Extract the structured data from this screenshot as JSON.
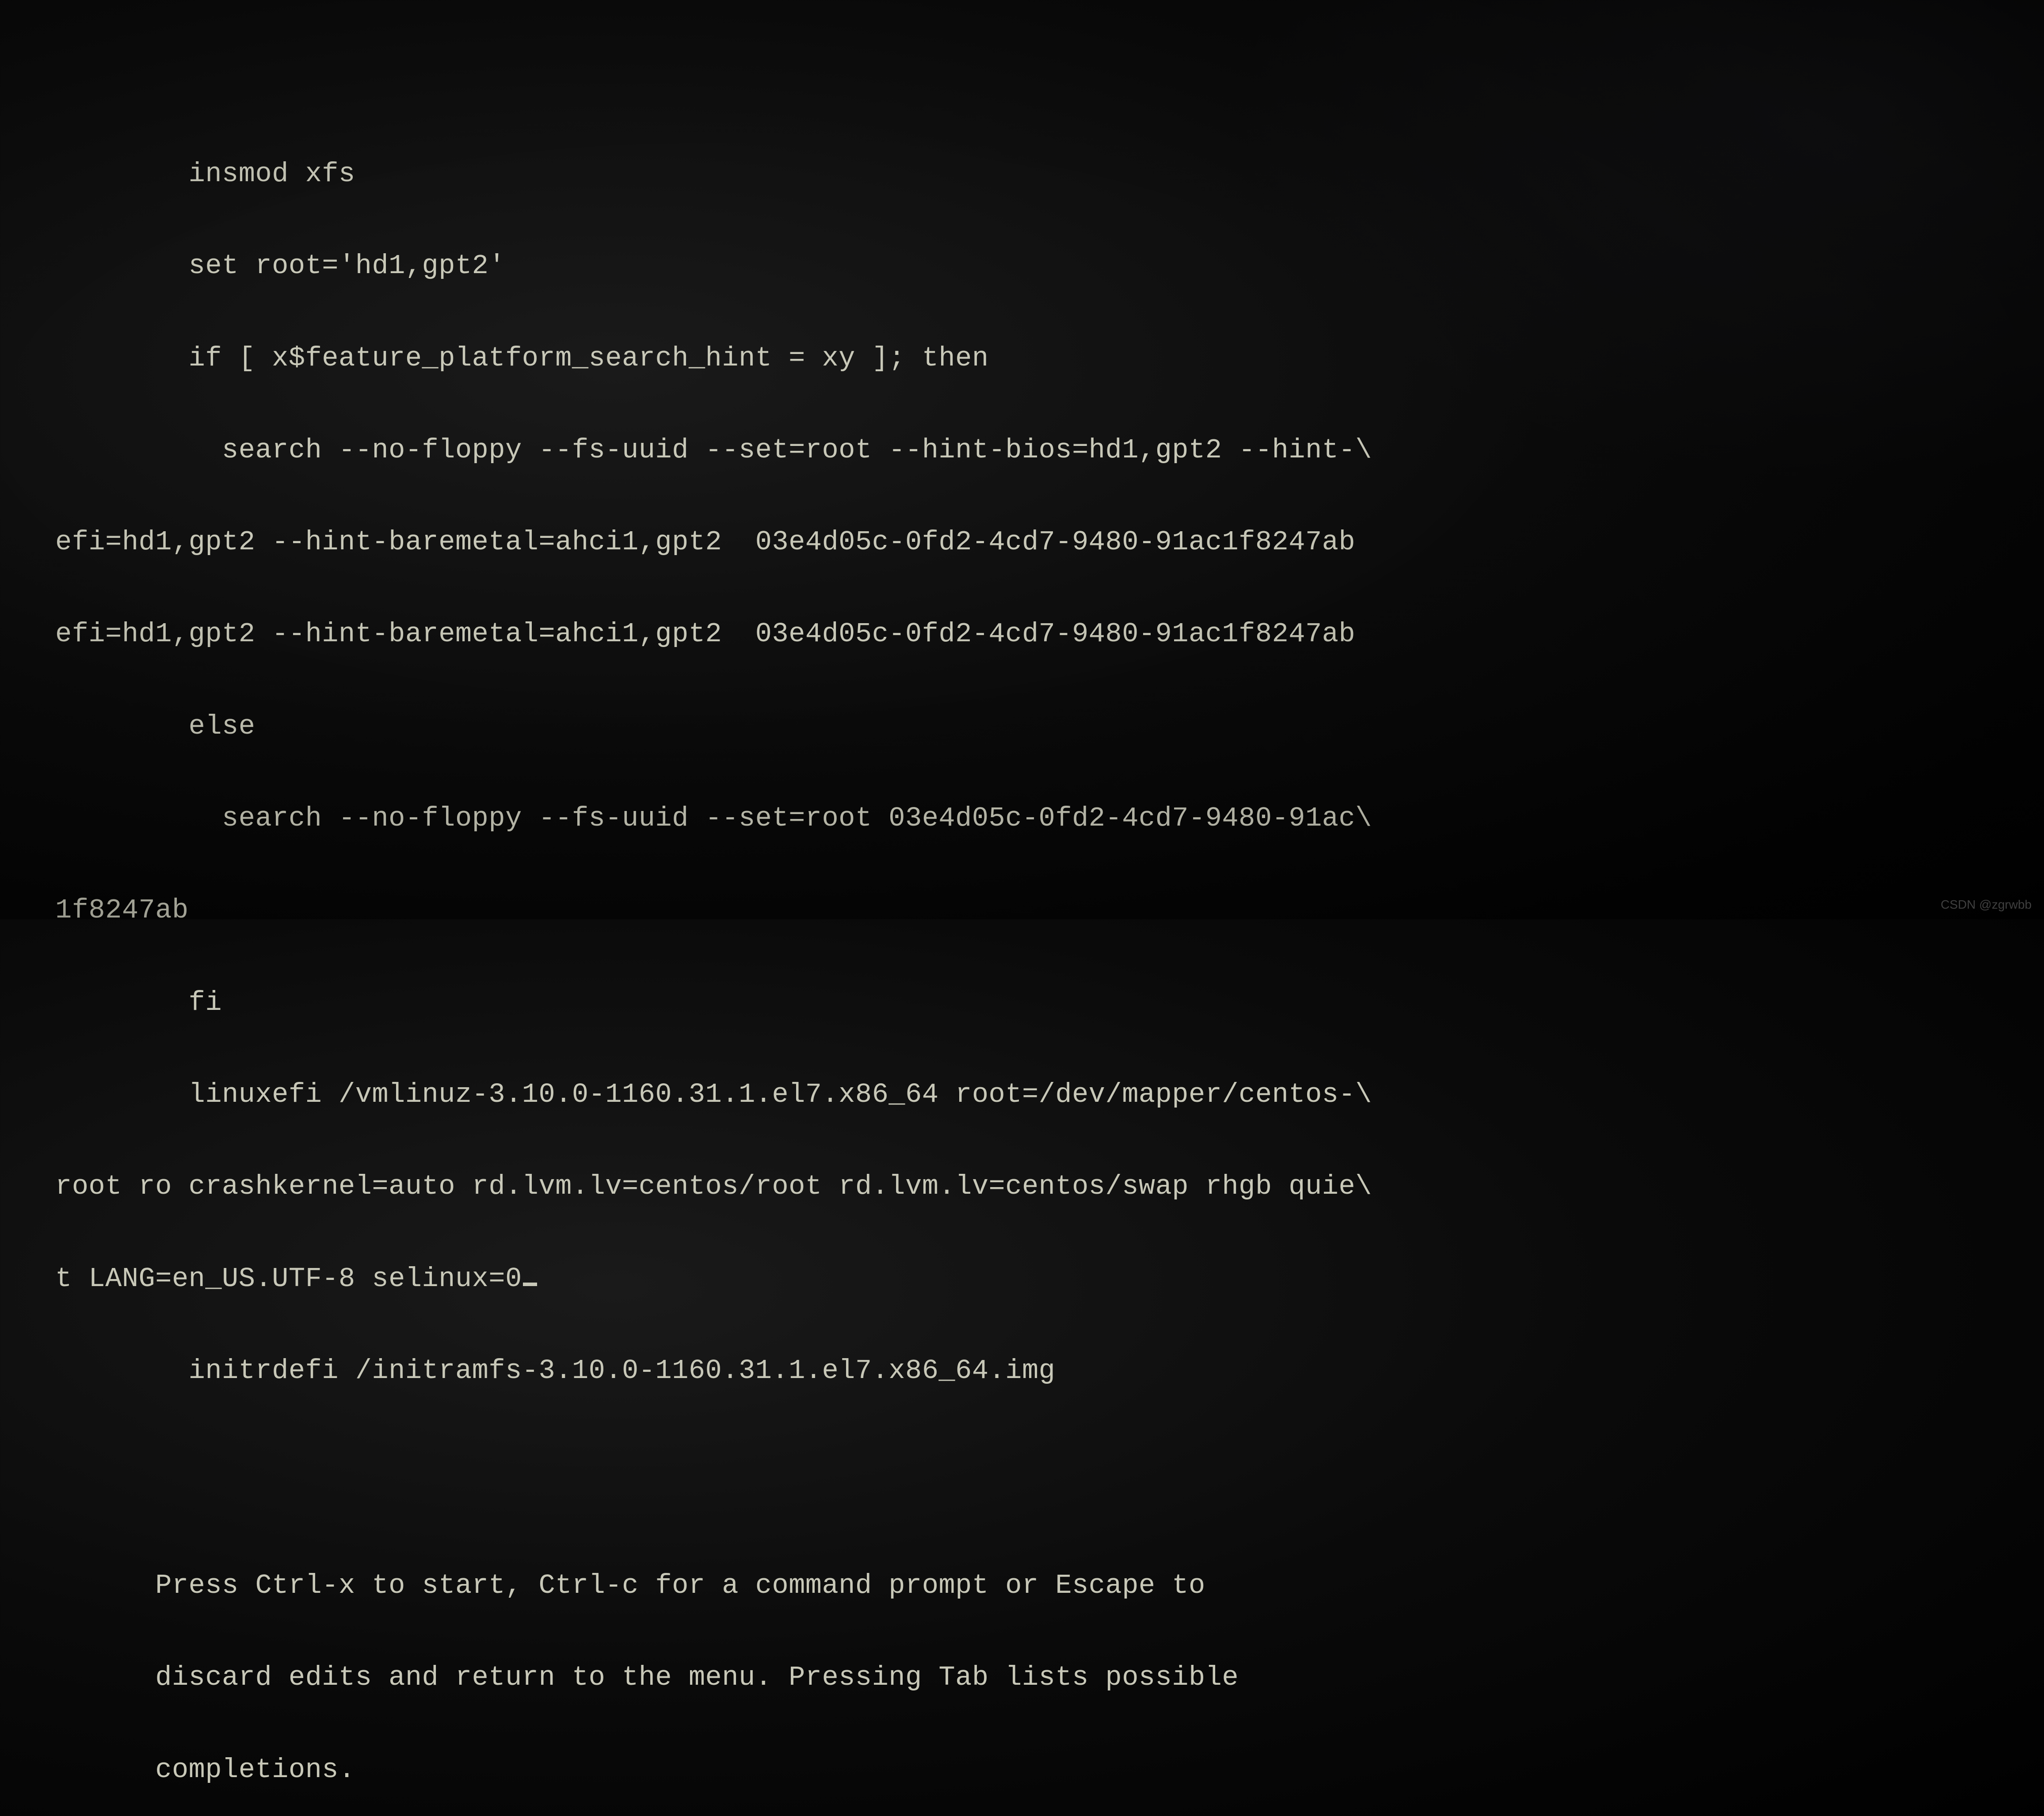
{
  "editor": {
    "lines": [
      "        insmod xfs",
      "        set root='hd1,gpt2'",
      "        if [ x$feature_platform_search_hint = xy ]; then",
      "          search --no-floppy --fs-uuid --set=root --hint-bios=hd1,gpt2 --hint-\\",
      "efi=hd1,gpt2 --hint-baremetal=ahci1,gpt2  03e4d05c-0fd2-4cd7-9480-91ac1f8247ab",
      "efi=hd1,gpt2 --hint-baremetal=ahci1,gpt2  03e4d05c-0fd2-4cd7-9480-91ac1f8247ab",
      "        else",
      "          search --no-floppy --fs-uuid --set=root 03e4d05c-0fd2-4cd7-9480-91ac\\",
      "1f8247ab",
      "        fi",
      "        linuxefi /vmlinuz-3.10.0-1160.31.1.el7.x86_64 root=/dev/mapper/centos-\\",
      "root ro crashkernel=auto rd.lvm.lv=centos/root rd.lvm.lv=centos/swap rhgb quie\\",
      "t LANG=en_US.UTF-8 selinux=0",
      "        initrdefi /initramfs-3.10.0-1160.31.1.el7.x86_64.img",
      "",
      ""
    ],
    "cursor_line_index": 12
  },
  "hint": {
    "line1": "      Press Ctrl-x to start, Ctrl-c for a command prompt or Escape to",
    "line2": "      discard edits and return to the menu. Pressing Tab lists possible",
    "line3": "      completions."
  },
  "watermark": "CSDN @zgrwbb"
}
